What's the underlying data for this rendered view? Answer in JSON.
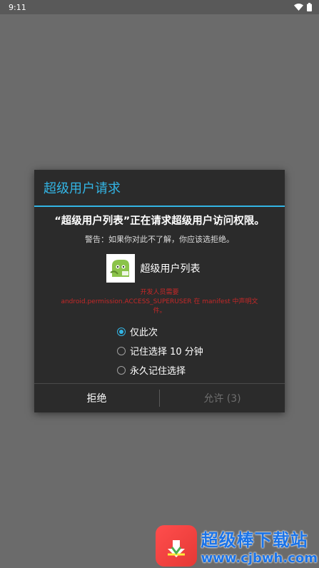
{
  "status_bar": {
    "time": "9:11"
  },
  "dialog": {
    "title": "超级用户请求",
    "headline": "“超级用户列表”正在请求超级用户访问权限。",
    "warning": "警告：如果你对此不了解，你应该选拒绝。",
    "app": {
      "name": "超级用户列表",
      "icon": "android-robot-icon"
    },
    "error_line1": "开发人员需要",
    "error_line2": "android.permission.ACCESS_SUPERUSER 在 manifest 中声明文",
    "error_line3": "件。",
    "options": [
      {
        "label": "仅此次",
        "checked": true
      },
      {
        "label": "记住选择 10 分钟",
        "checked": false
      },
      {
        "label": "永久记住选择",
        "checked": false
      }
    ],
    "deny_label": "拒绝",
    "allow_label": "允许 (3)"
  },
  "watermark": {
    "title": "超级棒下载站",
    "url": "www.cjbwh.com"
  },
  "colors": {
    "accent": "#33b5e5",
    "error": "#c62828",
    "background": "#6b6b6b"
  }
}
